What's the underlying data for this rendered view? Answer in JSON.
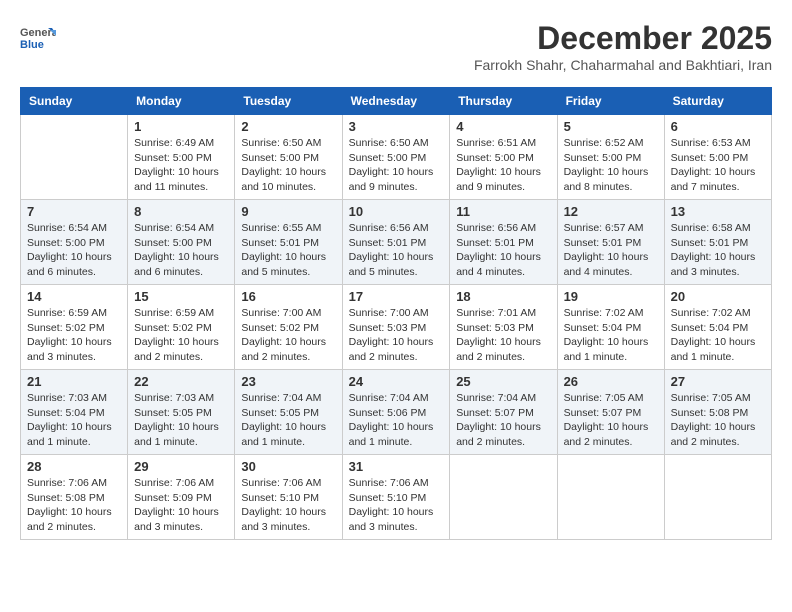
{
  "header": {
    "logo_general": "General",
    "logo_blue": "Blue",
    "month_title": "December 2025",
    "subtitle": "Farrokh Shahr, Chaharmahal and Bakhtiari, Iran"
  },
  "weekdays": [
    "Sunday",
    "Monday",
    "Tuesday",
    "Wednesday",
    "Thursday",
    "Friday",
    "Saturday"
  ],
  "weeks": [
    [
      {
        "day": "",
        "info": ""
      },
      {
        "day": "1",
        "info": "Sunrise: 6:49 AM\nSunset: 5:00 PM\nDaylight: 10 hours\nand 11 minutes."
      },
      {
        "day": "2",
        "info": "Sunrise: 6:50 AM\nSunset: 5:00 PM\nDaylight: 10 hours\nand 10 minutes."
      },
      {
        "day": "3",
        "info": "Sunrise: 6:50 AM\nSunset: 5:00 PM\nDaylight: 10 hours\nand 9 minutes."
      },
      {
        "day": "4",
        "info": "Sunrise: 6:51 AM\nSunset: 5:00 PM\nDaylight: 10 hours\nand 9 minutes."
      },
      {
        "day": "5",
        "info": "Sunrise: 6:52 AM\nSunset: 5:00 PM\nDaylight: 10 hours\nand 8 minutes."
      },
      {
        "day": "6",
        "info": "Sunrise: 6:53 AM\nSunset: 5:00 PM\nDaylight: 10 hours\nand 7 minutes."
      }
    ],
    [
      {
        "day": "7",
        "info": "Sunrise: 6:54 AM\nSunset: 5:00 PM\nDaylight: 10 hours\nand 6 minutes."
      },
      {
        "day": "8",
        "info": "Sunrise: 6:54 AM\nSunset: 5:00 PM\nDaylight: 10 hours\nand 6 minutes."
      },
      {
        "day": "9",
        "info": "Sunrise: 6:55 AM\nSunset: 5:01 PM\nDaylight: 10 hours\nand 5 minutes."
      },
      {
        "day": "10",
        "info": "Sunrise: 6:56 AM\nSunset: 5:01 PM\nDaylight: 10 hours\nand 5 minutes."
      },
      {
        "day": "11",
        "info": "Sunrise: 6:56 AM\nSunset: 5:01 PM\nDaylight: 10 hours\nand 4 minutes."
      },
      {
        "day": "12",
        "info": "Sunrise: 6:57 AM\nSunset: 5:01 PM\nDaylight: 10 hours\nand 4 minutes."
      },
      {
        "day": "13",
        "info": "Sunrise: 6:58 AM\nSunset: 5:01 PM\nDaylight: 10 hours\nand 3 minutes."
      }
    ],
    [
      {
        "day": "14",
        "info": "Sunrise: 6:59 AM\nSunset: 5:02 PM\nDaylight: 10 hours\nand 3 minutes."
      },
      {
        "day": "15",
        "info": "Sunrise: 6:59 AM\nSunset: 5:02 PM\nDaylight: 10 hours\nand 2 minutes."
      },
      {
        "day": "16",
        "info": "Sunrise: 7:00 AM\nSunset: 5:02 PM\nDaylight: 10 hours\nand 2 minutes."
      },
      {
        "day": "17",
        "info": "Sunrise: 7:00 AM\nSunset: 5:03 PM\nDaylight: 10 hours\nand 2 minutes."
      },
      {
        "day": "18",
        "info": "Sunrise: 7:01 AM\nSunset: 5:03 PM\nDaylight: 10 hours\nand 2 minutes."
      },
      {
        "day": "19",
        "info": "Sunrise: 7:02 AM\nSunset: 5:04 PM\nDaylight: 10 hours\nand 1 minute."
      },
      {
        "day": "20",
        "info": "Sunrise: 7:02 AM\nSunset: 5:04 PM\nDaylight: 10 hours\nand 1 minute."
      }
    ],
    [
      {
        "day": "21",
        "info": "Sunrise: 7:03 AM\nSunset: 5:04 PM\nDaylight: 10 hours\nand 1 minute."
      },
      {
        "day": "22",
        "info": "Sunrise: 7:03 AM\nSunset: 5:05 PM\nDaylight: 10 hours\nand 1 minute."
      },
      {
        "day": "23",
        "info": "Sunrise: 7:04 AM\nSunset: 5:05 PM\nDaylight: 10 hours\nand 1 minute."
      },
      {
        "day": "24",
        "info": "Sunrise: 7:04 AM\nSunset: 5:06 PM\nDaylight: 10 hours\nand 1 minute."
      },
      {
        "day": "25",
        "info": "Sunrise: 7:04 AM\nSunset: 5:07 PM\nDaylight: 10 hours\nand 2 minutes."
      },
      {
        "day": "26",
        "info": "Sunrise: 7:05 AM\nSunset: 5:07 PM\nDaylight: 10 hours\nand 2 minutes."
      },
      {
        "day": "27",
        "info": "Sunrise: 7:05 AM\nSunset: 5:08 PM\nDaylight: 10 hours\nand 2 minutes."
      }
    ],
    [
      {
        "day": "28",
        "info": "Sunrise: 7:06 AM\nSunset: 5:08 PM\nDaylight: 10 hours\nand 2 minutes."
      },
      {
        "day": "29",
        "info": "Sunrise: 7:06 AM\nSunset: 5:09 PM\nDaylight: 10 hours\nand 3 minutes."
      },
      {
        "day": "30",
        "info": "Sunrise: 7:06 AM\nSunset: 5:10 PM\nDaylight: 10 hours\nand 3 minutes."
      },
      {
        "day": "31",
        "info": "Sunrise: 7:06 AM\nSunset: 5:10 PM\nDaylight: 10 hours\nand 3 minutes."
      },
      {
        "day": "",
        "info": ""
      },
      {
        "day": "",
        "info": ""
      },
      {
        "day": "",
        "info": ""
      }
    ]
  ]
}
